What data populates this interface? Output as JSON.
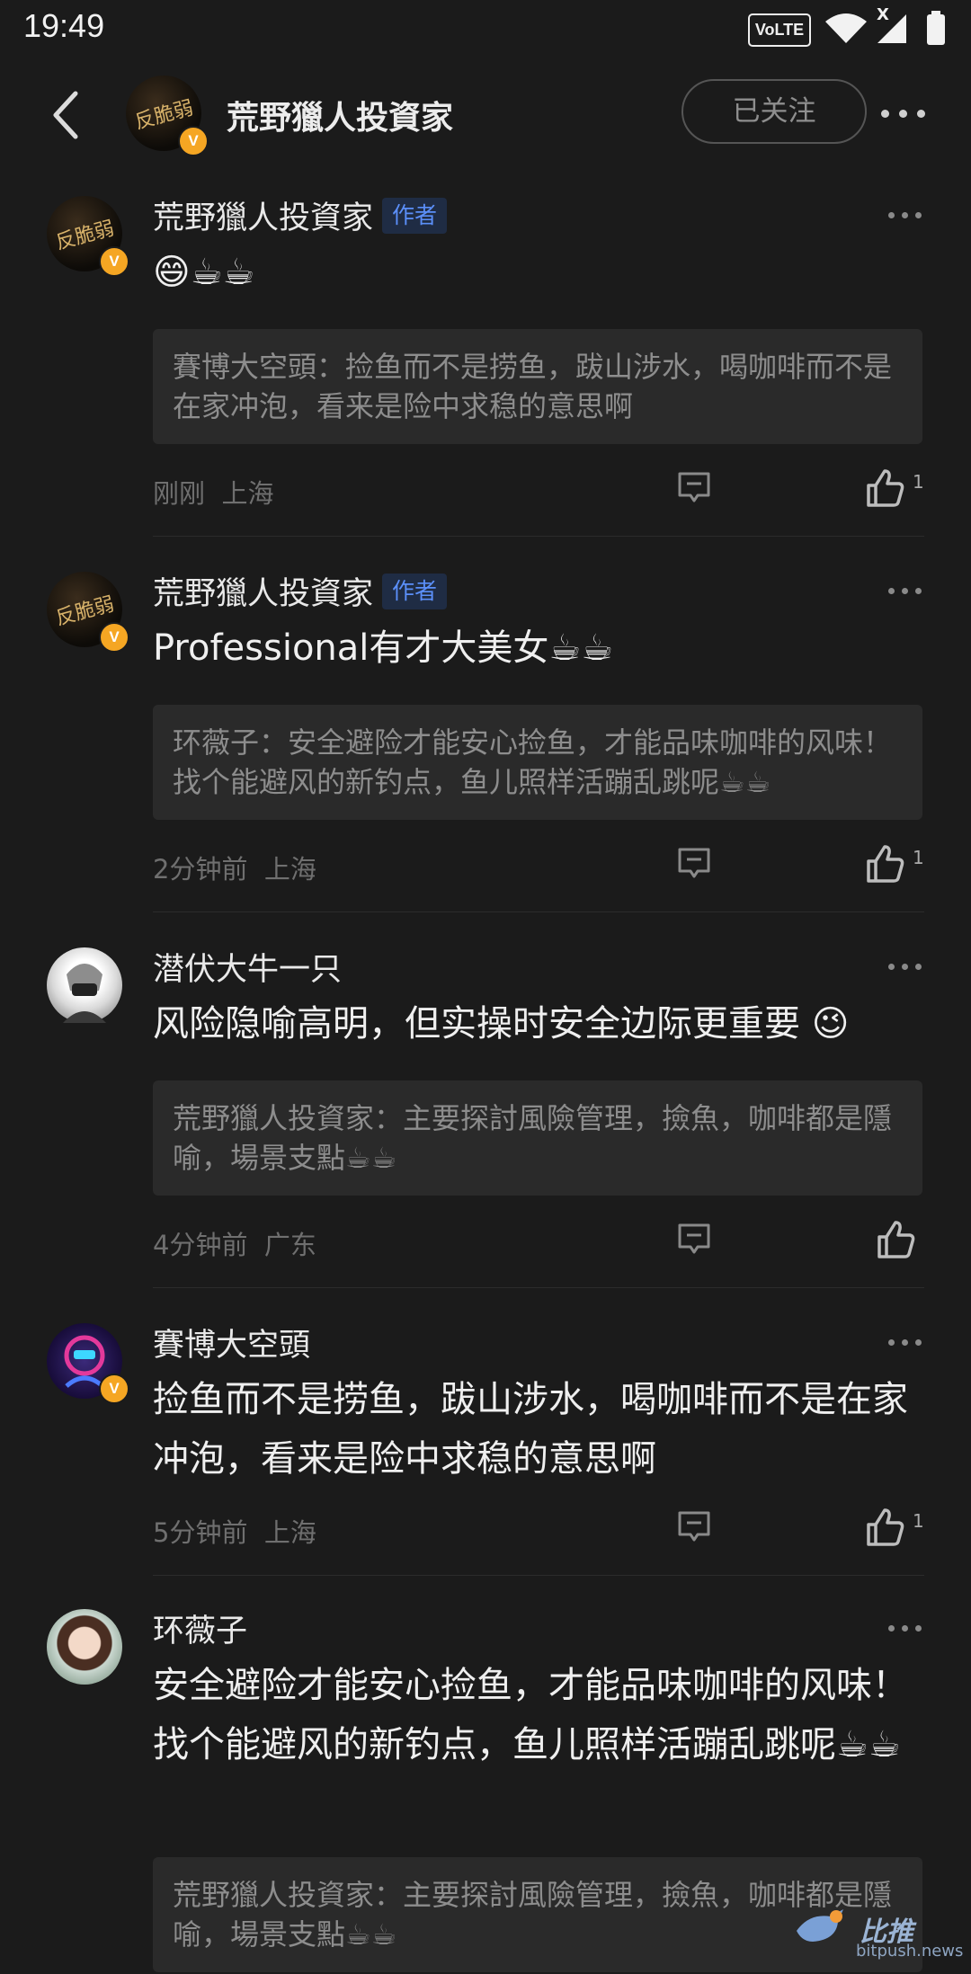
{
  "status": {
    "time": "19:49",
    "volte": "VoLTE",
    "signal_x": "X"
  },
  "header": {
    "title": "荒野獵人投資家",
    "follow_label": "已关注",
    "avatar_text": "反脆弱"
  },
  "author_label": "作者",
  "comments": [
    {
      "name": "荒野獵人投資家",
      "author": true,
      "avatar_text": "反脆弱",
      "body": "😄☕☕",
      "quote": "賽博大空頭：捡鱼而不是捞鱼，跋山涉水，喝咖啡而不是在家冲泡，看来是险中求稳的意思啊",
      "time": "刚刚",
      "location": "上海",
      "likes": "1"
    },
    {
      "name": "荒野獵人投資家",
      "author": true,
      "avatar_text": "反脆弱",
      "body": "Professional有才大美女☕☕",
      "quote": "环薇子：安全避险才能安心捡鱼，才能品味咖啡的风味！找个能避风的新钓点，鱼儿照样活蹦乱跳呢☕☕",
      "time": "2分钟前",
      "location": "上海",
      "likes": "1"
    },
    {
      "name": "潜伏大牛一只",
      "author": false,
      "body": "风险隐喻高明，但实操时安全边际更重要 😉",
      "quote": "荒野獵人投資家：主要探討風險管理，撿魚，咖啡都是隱喻，場景支點☕☕",
      "time": "4分钟前",
      "location": "广东",
      "likes": ""
    },
    {
      "name": "賽博大空頭",
      "author": false,
      "body": "捡鱼而不是捞鱼，跋山涉水，喝咖啡而不是在家冲泡，看来是险中求稳的意思啊",
      "time": "5分钟前",
      "location": "上海",
      "likes": "1"
    },
    {
      "name": "环薇子",
      "author": false,
      "body": "安全避险才能安心捡鱼，才能品味咖啡的风味！找个能避风的新钓点，鱼儿照样活蹦乱跳呢☕☕",
      "quote": "荒野獵人投資家：主要探討風險管理，撿魚，咖啡都是隱喻，場景支點☕☕"
    }
  ],
  "watermark": {
    "text": "比推",
    "url": "bitpush.news"
  },
  "colors": {
    "background": "#1b1b1b",
    "author_tag": "#5b8ff9",
    "vip_badge": "#f5a623"
  }
}
